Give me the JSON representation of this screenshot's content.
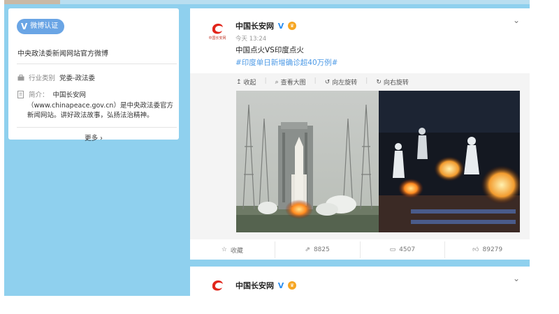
{
  "left_card": {
    "badge_label": "微博认证",
    "official_text": "中央政法委新闻网站官方微博",
    "industry_label": "行业类别",
    "industry_value": "党委-政法委",
    "intro_label": "简介：",
    "intro_line1": "中国长安网",
    "intro_line2": "（www.chinapeace.gov.cn）是中央政法委官方",
    "intro_line3": "新闻网站。讲好政法故事，弘扬法治精神。",
    "more_label": "更多 ›"
  },
  "post": {
    "user_name": "中国长安网",
    "time": "今天 13:24",
    "text": "中国点火VS印度点火",
    "hashtag": "#印度单日新增确诊超40万例#",
    "logo_caption": "中国长安网",
    "media_tools": [
      "收起",
      "查看大图",
      "向左旋转",
      "向右旋转"
    ],
    "actions": {
      "favorite": "收藏",
      "repost": "8825",
      "comment": "4507",
      "like": "89279"
    }
  },
  "post2": {
    "user_name": "中国长安网"
  },
  "colors": {
    "background_blue": "#8fd0ee",
    "link_blue": "#4d9ae6",
    "badge_blue": "#6aa5e5",
    "logo_red": "#e1251b"
  }
}
